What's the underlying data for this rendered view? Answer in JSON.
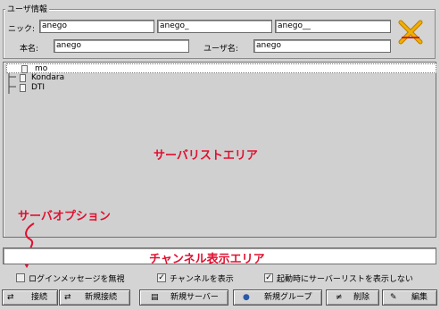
{
  "user_info": {
    "legend": "ユーザ情報",
    "nick_label": "ニック:",
    "nick_values": [
      "anego",
      "anego_",
      "anego__"
    ],
    "real_name_label": "本名:",
    "real_name_value": "anego",
    "username_label": "ユーザ名:",
    "username_value": "anego"
  },
  "server_tree": {
    "items": [
      "mo",
      "Kondara",
      "DTI"
    ]
  },
  "annotations": {
    "server_list_area": "サーバリストエリア",
    "server_option": "サーバオプション",
    "channel_display_area": "チャンネル表示エリア"
  },
  "options": [
    {
      "label": "ログインメッセージを無視",
      "checked": false
    },
    {
      "label": "チャンネルを表示",
      "checked": true
    },
    {
      "label": "起動時にサーバーリストを表示しない",
      "checked": true
    }
  ],
  "buttons": [
    {
      "label": "接続",
      "icon": "⇄"
    },
    {
      "label": "新規接続",
      "icon": "⇄"
    },
    {
      "label": "新規サーバー",
      "icon": "▤"
    },
    {
      "label": "新規グループ",
      "icon": "●"
    },
    {
      "label": "削除",
      "icon": "≠"
    },
    {
      "label": "編集",
      "icon": "✎"
    }
  ],
  "colors": {
    "annotation": "#e01030",
    "background": "#d4d4d4"
  }
}
